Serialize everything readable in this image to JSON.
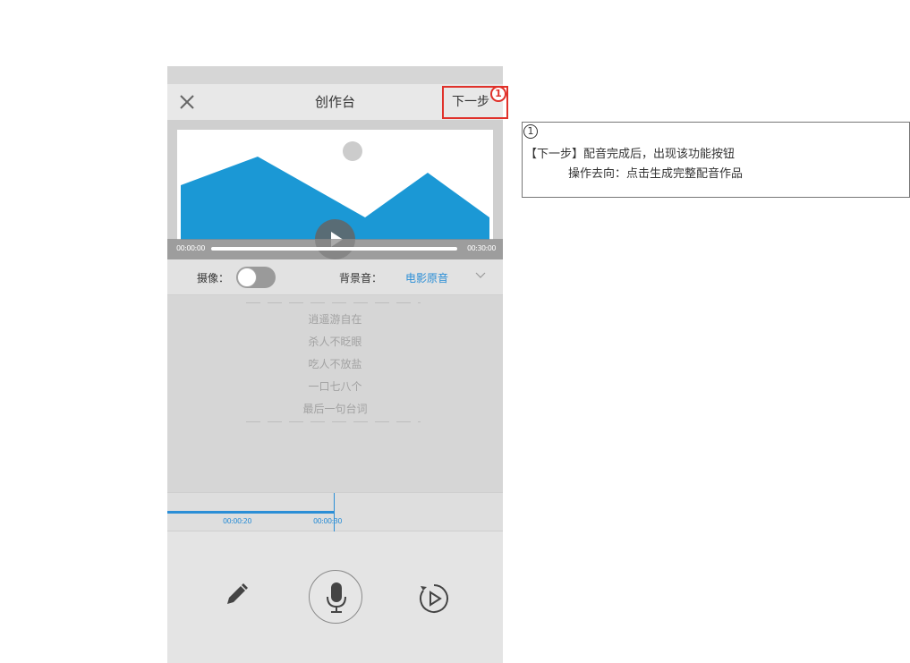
{
  "nav": {
    "title": "创作台",
    "next_label": "下一步",
    "badge": "1"
  },
  "video": {
    "time_start": "00:00:00",
    "time_end": "00:30:00",
    "colors": {
      "mountain": "#1b98d5",
      "sun": "#cccccc",
      "play_bg": "#646464"
    }
  },
  "controls": {
    "camera_label": "摄像：",
    "camera_enabled": false,
    "bgm_label": "背景音：",
    "bgm_value": "电影原音"
  },
  "lines": [
    "逍遥游自在",
    "杀人不眨眼",
    "吃人不放盐",
    "一口七八个",
    "最后一句台词"
  ],
  "timeline": {
    "ticks": [
      "00:00:20",
      "00:00:30"
    ],
    "accent": "#2b8ed6"
  },
  "annotation": {
    "number": "1",
    "line1": "【下一步】配音完成后，出现该功能按钮",
    "line2": "操作去向：点击生成完整配音作品",
    "highlight_color": "#e0312a"
  }
}
